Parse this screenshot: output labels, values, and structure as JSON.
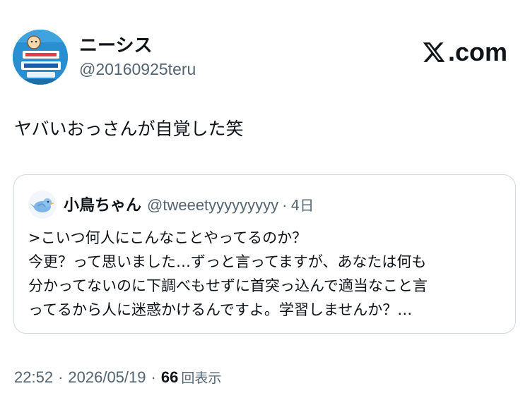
{
  "author": {
    "display_name": "ニーシス",
    "handle": "@20160925teru",
    "avatar_icon": "soap-package-avatar"
  },
  "brand": {
    "label": ".com",
    "icon": "x-logo-icon"
  },
  "tweet": {
    "text": "ヤバいおっさんが自覚した笑"
  },
  "quote": {
    "display_name": "小鳥ちゃん",
    "handle": "@tweeetyyyyyyyyy",
    "separator": "·",
    "time": "4日",
    "avatar_icon": "bird-avatar",
    "lines": [
      ">こいつ何人にこんなことやってるのか？",
      "今更？って思いました…ずっと言ってますが、あなたは何も",
      "分かってないのに下調べもせずに首突っ込んで適当なこと言",
      "ってるから人に迷惑かけるんですよ。学習しませんか？…"
    ]
  },
  "footer": {
    "time": "22:52",
    "separator": "·",
    "date": "2026/05/19",
    "views_count": "66",
    "views_label": "回表示"
  },
  "colors": {
    "text": "#0f1419",
    "secondary": "#536471",
    "border": "#cfd9de"
  }
}
